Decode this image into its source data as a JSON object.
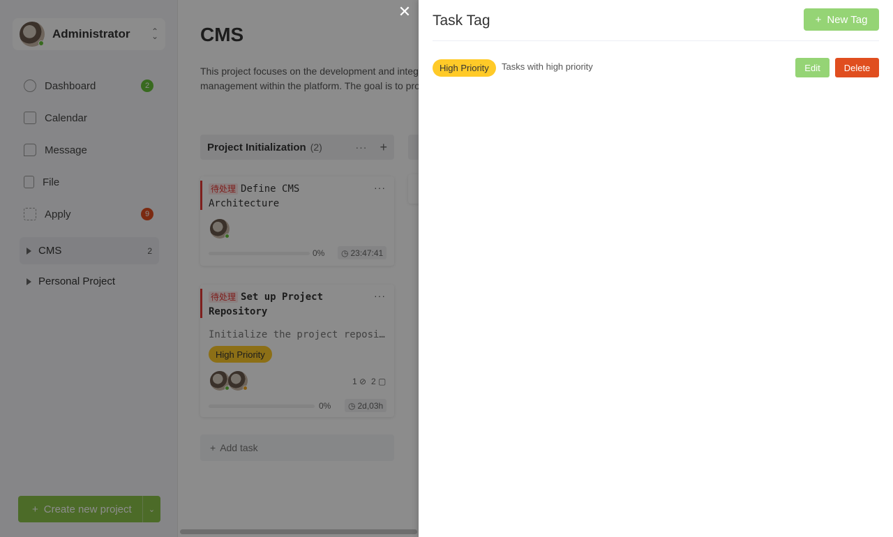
{
  "colors": {
    "accent_green": "#8bc34a",
    "light_green": "#95d475",
    "danger": "#e04e1f",
    "tag_yellow": "#ffca28",
    "status_red": "#e53935",
    "overlay": "rgba(0,0,0,0.45)"
  },
  "sidebar": {
    "user": {
      "name": "Administrator",
      "online": true
    },
    "switch_icon": "chevron-up-down-icon",
    "nav": [
      {
        "label": "Dashboard",
        "icon": "dashboard-icon",
        "count": "2",
        "count_color": "#67c23a"
      },
      {
        "label": "Calendar",
        "icon": "calendar-icon",
        "count": "",
        "count_color": ""
      },
      {
        "label": "Message",
        "icon": "message-icon",
        "count": "",
        "count_color": ""
      },
      {
        "label": "File",
        "icon": "file-icon",
        "count": "",
        "count_color": ""
      },
      {
        "label": "Apply",
        "icon": "apply-icon",
        "count": "9",
        "count_color": "#e04e1f"
      }
    ],
    "projects": [
      {
        "name": "CMS",
        "count": "2",
        "active": true
      },
      {
        "name": "Personal Project",
        "count": "",
        "active": false
      }
    ],
    "create_button": {
      "label": "Create new project",
      "icon": "plus-icon"
    }
  },
  "main": {
    "title": "CMS",
    "description": "This project focuses on the development and integ management within the platform. The goal is to pro",
    "columns": [
      {
        "name": "Project Initialization",
        "count": "(2)",
        "more": "···",
        "add": "+",
        "cards": [
          {
            "status": "待处理",
            "title": "Define CMS Architecture",
            "progress": "0%",
            "time": "23:47:41"
          },
          {
            "status": "待处理",
            "title": "Set up Project Repository",
            "description": "Initialize the project reposi…",
            "tag": "High Priority",
            "links": "1",
            "comments": "2",
            "progress": "0%",
            "time": "2d,03h"
          }
        ],
        "add_task": "Add task"
      }
    ]
  },
  "drawer": {
    "close": "✕",
    "title": "Task Tag",
    "new_tag": "New Tag",
    "tags": [
      {
        "name": "High Priority",
        "description": "Tasks with high priority",
        "color": "#ffca28",
        "edit": "Edit",
        "delete": "Delete"
      }
    ]
  }
}
